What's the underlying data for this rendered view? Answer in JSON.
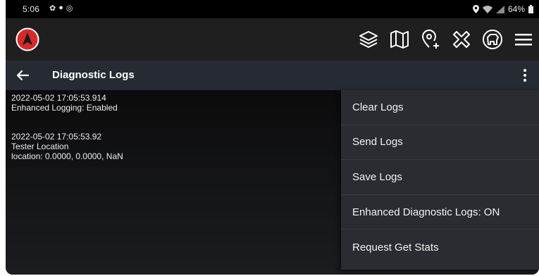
{
  "status_bar": {
    "time": "5:06",
    "battery": "64%"
  },
  "toolbar": {
    "icons": [
      "compass-icon",
      "layers-icon",
      "map-icon",
      "add-location-icon",
      "tools-icon",
      "dog-icon",
      "menu-icon"
    ]
  },
  "title_bar": {
    "title": "Diagnostic Logs"
  },
  "logs": [
    {
      "timestamp": "2022-05-02 17:05:53.914",
      "lines": [
        "Enhanced Logging: Enabled"
      ]
    },
    {
      "timestamp": "2022-05-02 17:05:53.92",
      "lines": [
        "Tester Location",
        "location: 0.0000, 0.0000, NaN"
      ]
    }
  ],
  "menu": {
    "items": [
      "Clear Logs",
      "Send Logs",
      "Save Logs",
      "Enhanced Diagnostic Logs: ON",
      "Request Get Stats"
    ]
  },
  "colors": {
    "status_bar_bg": "#000000",
    "toolbar_bg": "#1f1f1f",
    "title_bar_bg": "#262a33",
    "menu_bg": "#2b2c31",
    "compass_red": "#d62a2a"
  }
}
